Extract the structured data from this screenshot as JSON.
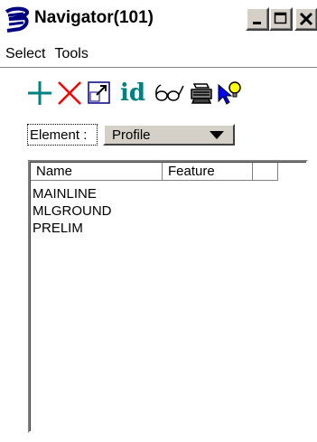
{
  "window": {
    "title": "Navigator(101)",
    "buttons": [
      "minimize",
      "maximize",
      "close"
    ]
  },
  "menu": {
    "items": [
      "Select",
      "Tools"
    ]
  },
  "toolbar": {
    "tools": [
      {
        "name": "add-icon",
        "color": "#008080"
      },
      {
        "name": "delete-icon",
        "color": "#ff0000"
      },
      {
        "name": "zoom-window-icon",
        "color": "#000080"
      },
      {
        "name": "id-text",
        "label": "id",
        "color": "#008080"
      },
      {
        "name": "glasses-icon",
        "color": "#000000"
      },
      {
        "name": "printer-icon",
        "color": "#000000"
      },
      {
        "name": "pointer-bulb-icon",
        "color": "#0000ff"
      }
    ]
  },
  "element": {
    "label": "Element :",
    "selected": "Profile"
  },
  "list": {
    "columns": [
      "Name",
      "Feature",
      ""
    ],
    "rows": [
      "MAINLINE",
      "MLGROUND",
      "PRELIM"
    ]
  }
}
